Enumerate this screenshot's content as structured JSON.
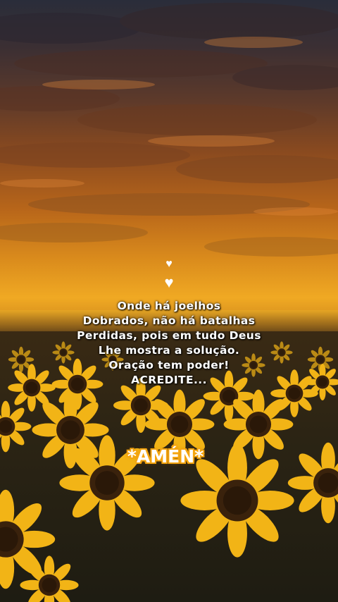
{
  "quote": {
    "lines": [
      "Onde há joelhos",
      "Dobrados, não há batalhas",
      "Perdidas, pois em tudo Deus",
      "Lhe mostra a solução.",
      "Oração tem poder!",
      "ACREDITE..."
    ]
  },
  "badge": {
    "text": "*AMÉN*"
  },
  "icons": {
    "heart_small": "heart-icon",
    "heart_large": "heart-icon"
  },
  "colors": {
    "text": "#ffffff",
    "badge": "#f5a50f",
    "sky_glow": "#f0a923"
  }
}
